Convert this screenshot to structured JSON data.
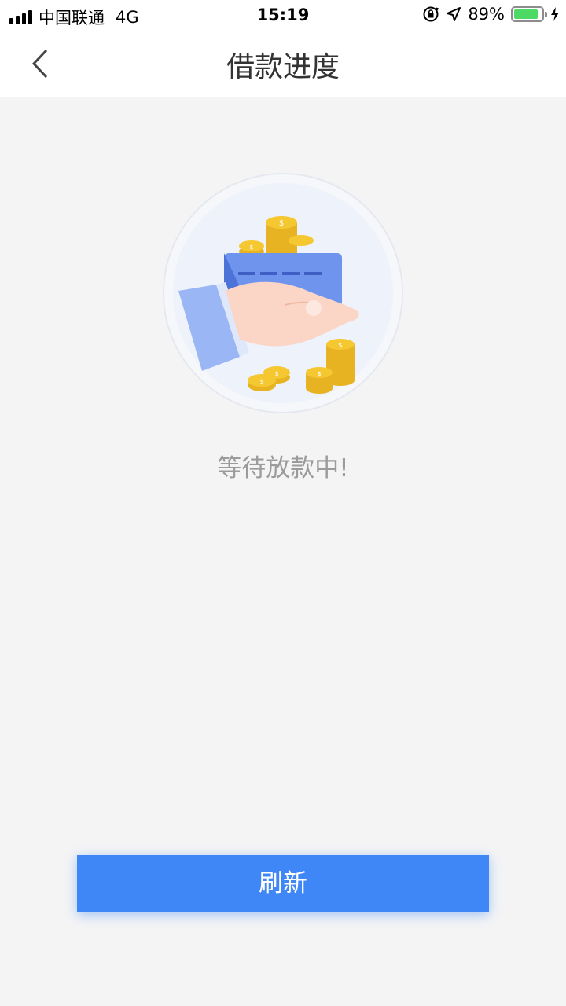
{
  "status_bar": {
    "carrier": "中国联通",
    "network": "4G",
    "time": "15:19",
    "battery_percent": "89%",
    "battery_level": 0.89,
    "icons": [
      "signal-icon",
      "orientation-lock-icon",
      "location-icon",
      "battery-icon",
      "charging-icon"
    ]
  },
  "nav": {
    "title": "借款进度",
    "back_icon": "chevron-left-icon"
  },
  "main": {
    "illustration": "hand-card-coins-illustration",
    "status_text": "等待放款中!",
    "refresh_label": "刷新"
  },
  "colors": {
    "accent": "#3f87f7",
    "background": "#f4f4f5",
    "status_text": "#9b9b9b",
    "battery": "#4cd964",
    "coin": "#f5c832"
  }
}
